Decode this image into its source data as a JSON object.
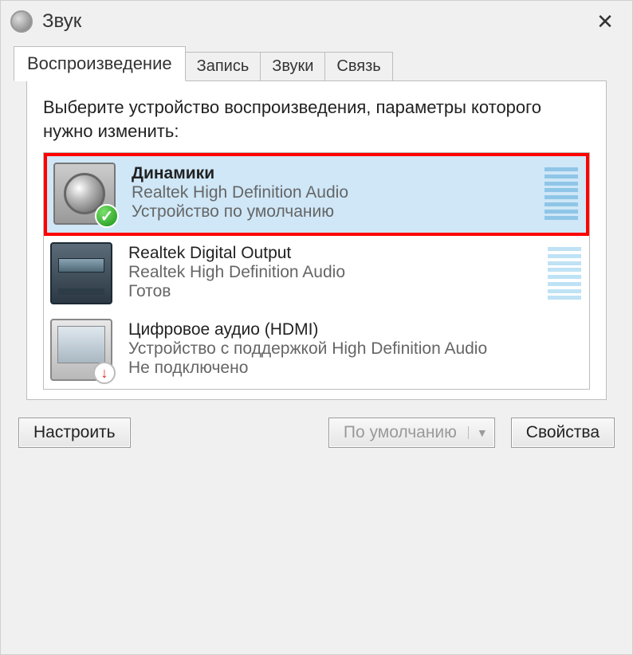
{
  "title": "Звук",
  "tabs": [
    {
      "label": "Воспроизведение",
      "active": true
    },
    {
      "label": "Запись",
      "active": false
    },
    {
      "label": "Звуки",
      "active": false
    },
    {
      "label": "Связь",
      "active": false
    }
  ],
  "instruction": "Выберите устройство воспроизведения, параметры которого нужно изменить:",
  "devices": [
    {
      "name": "Динамики",
      "subtitle": "Realtek High Definition Audio",
      "status": "Устройство по умолчанию",
      "icon": "speaker",
      "badge": "check",
      "selected": true,
      "meter": "full"
    },
    {
      "name": "Realtek Digital Output",
      "subtitle": "Realtek High Definition Audio",
      "status": "Готов",
      "icon": "digital",
      "badge": null,
      "selected": false,
      "meter": "dim"
    },
    {
      "name": "Цифровое аудио (HDMI)",
      "subtitle": "Устройство с поддержкой High Definition Audio",
      "status": "Не подключено",
      "icon": "monitor",
      "badge": "down",
      "selected": false,
      "meter": "none"
    }
  ],
  "buttons": {
    "configure": "Настроить",
    "default": "По умолчанию",
    "properties": "Свойства"
  }
}
